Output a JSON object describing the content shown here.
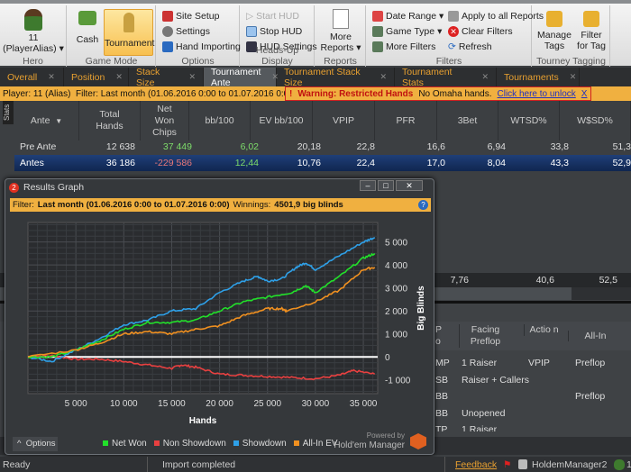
{
  "ribbon": {
    "hero": {
      "name": "11",
      "alias": "(PlayerAlias)",
      "group": "Hero"
    },
    "game_mode": {
      "cash": "Cash",
      "tournament": "Tournament",
      "group": "Game Mode"
    },
    "options": {
      "site_setup": "Site Setup",
      "settings": "Settings",
      "hand_importing": "Hand Importing",
      "group": "Options"
    },
    "hud": {
      "start": "Start HUD",
      "stop": "Stop HUD",
      "settings": "HUD Settings",
      "group": "Heads-Up Display"
    },
    "reports": {
      "more": "More",
      "reports": "Reports",
      "group": "Reports"
    },
    "filters": {
      "date_range": "Date Range",
      "game_type": "Game Type",
      "more_filters": "More Filters",
      "apply_all": "Apply to all Reports",
      "clear": "Clear Filters",
      "refresh": "Refresh",
      "group": "Filters"
    },
    "tagging": {
      "manage1": "Manage",
      "manage2": "Tags",
      "filter1": "Filter",
      "filter2": "for Tag",
      "group": "Tourney Tagging"
    }
  },
  "tabs": [
    {
      "label": "Overall"
    },
    {
      "label": "Position"
    },
    {
      "label": "Stack Size"
    },
    {
      "label": "Tournament Ante",
      "active": true
    },
    {
      "label": "Tournament Stack Size"
    },
    {
      "label": "Tournament Stats"
    },
    {
      "label": "Tournaments"
    }
  ],
  "filterbar": {
    "player": "Player: 11 (Alias)",
    "filter": "Filter: Last month (01.06.2016 0:00 to 01.07.2016 0:00)",
    "warning": "Warning: Restricted Hands",
    "omaha": "No Omaha hands.",
    "unlock": "Click here to unlock",
    "close": "X"
  },
  "stats": {
    "side_tab": "Stats",
    "columns": [
      "Ante",
      "Total Hands",
      "Net Won Chips",
      "bb/100",
      "EV bb/100",
      "VPIP",
      "PFR",
      "3Bet",
      "WTSD%",
      "W$SD%"
    ],
    "rows": [
      {
        "cells": [
          "Pre Ante",
          "12 638",
          "37 449",
          "6,02",
          "20,18",
          "22,8",
          "16,6",
          "6,94",
          "33,8",
          "51,3"
        ]
      },
      {
        "cells": [
          "Antes",
          "36 186",
          "-229 586",
          "12,44",
          "10,76",
          "22,4",
          "17,0",
          "8,04",
          "43,3",
          "52,9"
        ],
        "selected": true
      }
    ],
    "totals": [
      "7,76",
      "40,6",
      "52,5"
    ]
  },
  "hands_table": {
    "columns": [
      "P o",
      "Facing Preflop",
      "Actio n",
      "All-In"
    ],
    "rows": [
      [
        "MP",
        "1 Raiser",
        "VPIP",
        "Preflop"
      ],
      [
        "SB",
        "Raiser + Callers",
        "",
        ""
      ],
      [
        "BB",
        "",
        "",
        "Preflop"
      ],
      [
        "BB",
        "Unopened",
        "",
        ""
      ],
      [
        "TP",
        "1 Raiser",
        "",
        ""
      ]
    ]
  },
  "graph_window": {
    "title": "Results Graph",
    "filter_label": "Filter:",
    "filter_value": "Last month (01.06.2016 0:00 to 01.07.2016 0:00)",
    "winnings_label": "Winnings:",
    "winnings_value": "4501,9 big blinds",
    "options": "Options",
    "powered_by": "Powered by",
    "brand": "Hold'em Manager",
    "brand_logo": "2"
  },
  "chart_data": {
    "type": "line",
    "xlabel": "Hands",
    "ylabel": "Big Blinds",
    "xlim": [
      0,
      36500
    ],
    "ylim": [
      -1600,
      5850
    ],
    "xticks": [
      5000,
      10000,
      15000,
      20000,
      25000,
      30000,
      35000
    ],
    "xtick_labels": [
      "5 000",
      "10 000",
      "15 000",
      "20 000",
      "25 000",
      "30 000",
      "35 000"
    ],
    "yticks": [
      -1000,
      0,
      1000,
      2000,
      3000,
      4000,
      5000
    ],
    "ytick_labels": [
      "-1 000",
      "0",
      "1 000",
      "2 000",
      "3 000",
      "4 000",
      "5 000"
    ],
    "grid": true,
    "legend_placement": "bottom",
    "series": [
      {
        "name": "Net Won",
        "color": "#22e02a",
        "x": [
          0,
          2500,
          5000,
          7500,
          10000,
          12500,
          15000,
          17500,
          20000,
          22500,
          25000,
          27500,
          29000,
          30000,
          32500,
          35000,
          36186
        ],
        "y": [
          0,
          0,
          300,
          700,
          1200,
          1500,
          1500,
          1600,
          2000,
          2400,
          2600,
          2800,
          3100,
          2800,
          3500,
          4300,
          4500
        ]
      },
      {
        "name": "Non Showdown",
        "color": "#e84040",
        "x": [
          0,
          2500,
          5000,
          7500,
          10000,
          12500,
          15000,
          16000,
          17500,
          20000,
          22500,
          25000,
          27500,
          30000,
          32500,
          34000,
          36186
        ],
        "y": [
          0,
          50,
          -100,
          -100,
          -200,
          -350,
          -500,
          -350,
          -450,
          -750,
          -800,
          -850,
          -900,
          -950,
          -800,
          -600,
          -750
        ]
      },
      {
        "name": "Showdown",
        "color": "#2ea0e8",
        "x": [
          0,
          2500,
          5000,
          7500,
          10000,
          12500,
          15000,
          17500,
          20000,
          22500,
          24000,
          25000,
          26500,
          28000,
          29000,
          30000,
          32500,
          35000,
          36186
        ],
        "y": [
          0,
          -200,
          300,
          800,
          1400,
          1600,
          2000,
          2100,
          2800,
          3300,
          3500,
          3300,
          3400,
          3900,
          4100,
          3800,
          4400,
          5000,
          5200
        ]
      },
      {
        "name": "All-In EV",
        "color": "#f09020",
        "x": [
          0,
          5000,
          7500,
          10000,
          12500,
          15000,
          17500,
          20000,
          22500,
          25000,
          26500,
          27000,
          30000,
          32500,
          35000,
          36186
        ],
        "y": [
          0,
          300,
          600,
          1000,
          1100,
          1000,
          1200,
          1350,
          1800,
          2100,
          2100,
          2000,
          2400,
          2900,
          3800,
          3900
        ]
      }
    ]
  },
  "status": {
    "ready": "Ready",
    "import": "Import completed",
    "feedback": "Feedback",
    "app": "HoldemManager2",
    "user": "1"
  }
}
